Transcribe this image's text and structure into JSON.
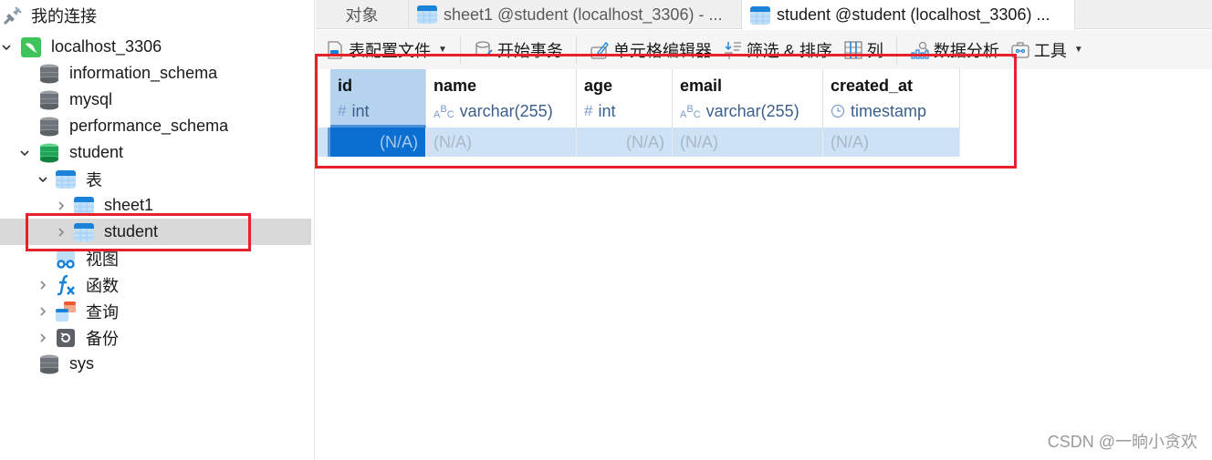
{
  "sidebar": {
    "root_label": "我的连接",
    "connection": "localhost_3306",
    "databases": [
      {
        "label": "information_schema"
      },
      {
        "label": "mysql"
      },
      {
        "label": "performance_schema"
      },
      {
        "label": "student"
      },
      {
        "label": "sys"
      }
    ],
    "student_children": {
      "tables_label": "表",
      "tables": [
        {
          "label": "sheet1"
        },
        {
          "label": "student"
        }
      ],
      "views_label": "视图",
      "functions_label": "函数",
      "queries_label": "查询",
      "backups_label": "备份"
    }
  },
  "tabs": [
    {
      "label": "对象"
    },
    {
      "label": "sheet1 @student (localhost_3306) - ..."
    },
    {
      "label": "student @student (localhost_3306) ..."
    }
  ],
  "toolbar": {
    "table_profile": "表配置文件",
    "begin_transaction": "开始事务",
    "cell_editor": "单元格编辑器",
    "filter_sort": "筛选 & 排序",
    "columns": "列",
    "data_analysis": "数据分析",
    "tools": "工具"
  },
  "grid": {
    "columns": [
      {
        "name": "id",
        "type": "int",
        "type_icon": "hash-icon"
      },
      {
        "name": "name",
        "type": "varchar(255)",
        "type_icon": "abc-icon"
      },
      {
        "name": "age",
        "type": "int",
        "type_icon": "hash-icon"
      },
      {
        "name": "email",
        "type": "varchar(255)",
        "type_icon": "abc-icon"
      },
      {
        "name": "created_at",
        "type": "timestamp",
        "type_icon": "clock-icon"
      }
    ],
    "row": [
      "(N/A)",
      "(N/A)",
      "(N/A)",
      "(N/A)",
      "(N/A)"
    ]
  },
  "type_glyphs": {
    "hash": "#",
    "abc": "ABC"
  },
  "watermark": "CSDN @一晌小贪欢",
  "colors": {
    "highlight": "#e8202a",
    "selected_cell": "#0a6fd1",
    "row_bg": "#cde2f5"
  }
}
